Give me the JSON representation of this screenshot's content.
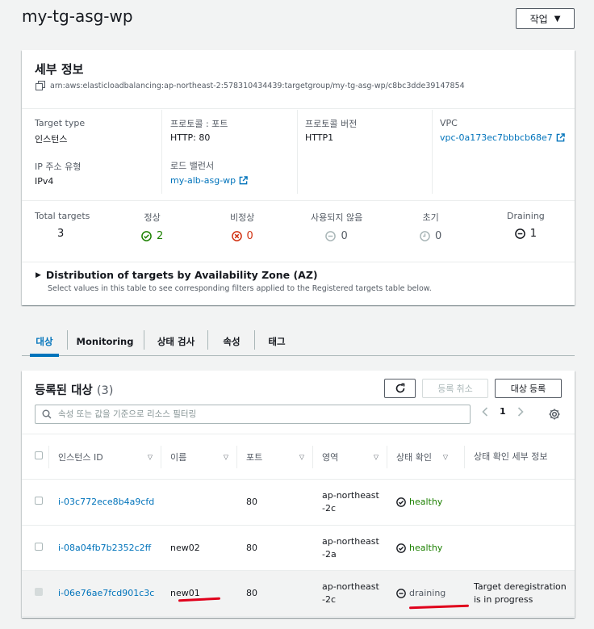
{
  "page": {
    "title": "my-tg-asg-wp",
    "action_label": "작업"
  },
  "details": {
    "title": "세부 정보",
    "arn": "arn:aws:elasticloadbalancing:ap-northeast-2:578310434439:targetgroup/my-tg-asg-wp/c8bc3dde39147854",
    "target_type_label": "Target type",
    "target_type_value": "인스턴스",
    "ip_type_label": "IP 주소 유형",
    "ip_type_value": "IPv4",
    "protocol_port_label": "프로토콜 : 포트",
    "protocol_port_value": "HTTP: 80",
    "lb_label": "로드 밸런서",
    "lb_value": "my-alb-asg-wp",
    "protocol_version_label": "프로토콜 버전",
    "protocol_version_value": "HTTP1",
    "vpc_label": "VPC",
    "vpc_value": "vpc-0a173ec7bbbcb68e7"
  },
  "stats": {
    "total": {
      "label": "Total targets",
      "value": "3"
    },
    "healthy": {
      "label": "정상",
      "value": "2"
    },
    "unhealthy": {
      "label": "비정상",
      "value": "0"
    },
    "unused": {
      "label": "사용되지 않음",
      "value": "0"
    },
    "initial": {
      "label": "초기",
      "value": "0"
    },
    "draining": {
      "label": "Draining",
      "value": "1"
    }
  },
  "az": {
    "title": "Distribution of targets by Availability Zone (AZ)",
    "subtitle": "Select values in this table to see corresponding filters applied to the Registered targets table below."
  },
  "tabs": [
    "대상",
    "Monitoring",
    "상태 검사",
    "속성",
    "태그"
  ],
  "targets": {
    "title": "등록된 대상",
    "count": "(3)",
    "deregister_label": "등록 취소",
    "register_label": "대상 등록",
    "search_placeholder": "속성 또는 값을 기준으로 리소스 필터링",
    "page_number": "1",
    "columns": [
      "인스턴스 ID",
      "이름",
      "포트",
      "영역",
      "상태 확인",
      "상태 확인 세부 정보"
    ],
    "rows": [
      {
        "instance_id": "i-03c772ece8b4a9cfd",
        "name": "",
        "port": "80",
        "zone": "ap-northeast-2c",
        "health": "healthy",
        "details": ""
      },
      {
        "instance_id": "i-08a04fb7b2352c2ff",
        "name": "new02",
        "port": "80",
        "zone": "ap-northeast-2a",
        "health": "healthy",
        "details": ""
      },
      {
        "instance_id": "i-06e76ae7fcd901c3c",
        "name": "new01",
        "port": "80",
        "zone": "ap-northeast-2c",
        "health": "draining",
        "details": "Target deregistration is in progress"
      }
    ]
  },
  "colors": {
    "link": "#0073bb",
    "healthy": "#1d8102",
    "unhealthy": "#d13212",
    "annotation": "#e0001b"
  }
}
